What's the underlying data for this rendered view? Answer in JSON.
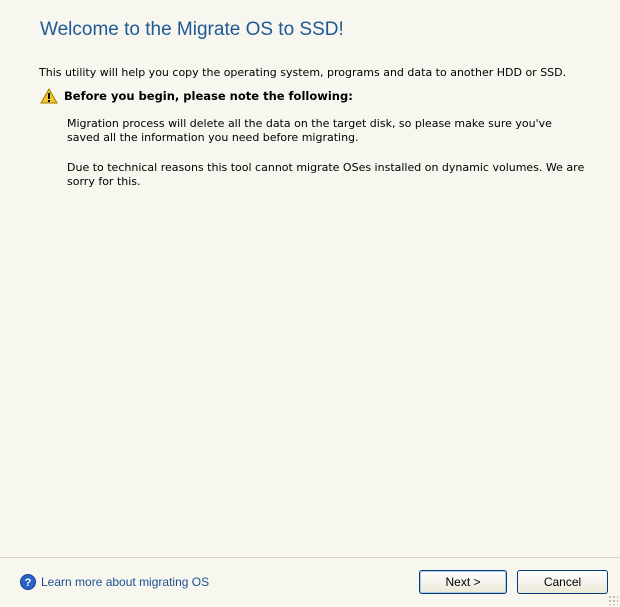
{
  "page": {
    "title": "Welcome to the Migrate OS to SSD!",
    "intro": "This utility will help you copy the operating system, programs and data to another HDD or SSD.",
    "warning_icon": "warning-triangle-icon",
    "warning_heading": "Before you begin, please note the following:",
    "notes": [
      "Migration process will delete all the data on the target disk, so please make sure you've saved all the information you need before migrating.",
      "Due to technical reasons this tool cannot migrate OSes installed on dynamic volumes. We are sorry for this."
    ]
  },
  "footer": {
    "help_icon": "help-question-icon",
    "learn_more_label": "Learn more about migrating OS",
    "next_label": "Next >",
    "cancel_label": "Cancel"
  },
  "colors": {
    "background": "#f7f6ef",
    "title": "#1e5a96",
    "link": "#1f4f8f",
    "button_border": "#003c74"
  }
}
